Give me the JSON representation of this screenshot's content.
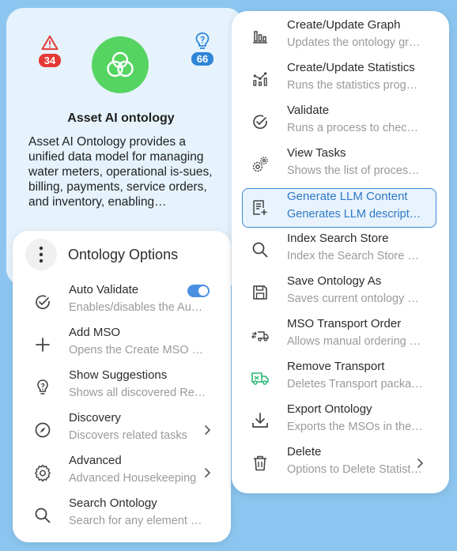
{
  "card": {
    "alert_count": "34",
    "suggestion_count": "66",
    "title": "Asset AI ontology",
    "description": "Asset AI Ontology provides a unified data model for managing water meters, operational is-sues, billing, payments, service orders, and inventory, enabling…",
    "logo_color": "#55d462"
  },
  "left_menu": {
    "title": "Ontology Options",
    "items": [
      {
        "label": "Auto Validate",
        "desc": "Enables/disables the Au…",
        "icon": "check-circle-icon",
        "toggle": true
      },
      {
        "label": "Add MSO",
        "desc": "Opens the Create MSO …",
        "icon": "plus-icon"
      },
      {
        "label": "Show Suggestions",
        "desc": "Shows all discovered Re…",
        "icon": "lightbulb-icon"
      },
      {
        "label": "Discovery",
        "desc": "Discovers related tasks",
        "icon": "compass-icon",
        "submenu": true
      },
      {
        "label": "Advanced",
        "desc": "Advanced Housekeeping",
        "icon": "gear-icon",
        "submenu": true
      },
      {
        "label": "Search Ontology",
        "desc": "Search for any element …",
        "icon": "search-icon"
      }
    ]
  },
  "right_menu": {
    "items": [
      {
        "label": "Create/Update Graph",
        "desc": "Updates the ontology gr…",
        "icon": "bar-chart-icon"
      },
      {
        "label": "Create/Update Statistics",
        "desc": "Runs the statistics prog…",
        "icon": "stats-chart-icon"
      },
      {
        "label": "Validate",
        "desc": "Runs a process to chec…",
        "icon": "check-circle-icon"
      },
      {
        "label": "View Tasks",
        "desc": "Shows the list of proces…",
        "icon": "gears-icon"
      },
      {
        "label": "Generate LLM Content",
        "desc": "Generates LLM descript…",
        "icon": "document-add-icon",
        "selected": true
      },
      {
        "label": "Index Search Store",
        "desc": "Index the Search Store …",
        "icon": "search-icon"
      },
      {
        "label": "Save Ontology As",
        "desc": "Saves current ontology …",
        "icon": "save-icon"
      },
      {
        "label": "MSO Transport Order",
        "desc": "Allows manual ordering …",
        "icon": "transport-order-icon"
      },
      {
        "label": "Remove Transport",
        "desc": "Deletes Transport packa…",
        "icon": "truck-icon"
      },
      {
        "label": "Export Ontology",
        "desc": "Exports the MSOs in the…",
        "icon": "download-icon"
      },
      {
        "label": "Delete",
        "desc": "Options to Delete Statist…",
        "icon": "trash-icon",
        "submenu": true
      }
    ]
  },
  "colors": {
    "background": "#8cc6f0",
    "accent_blue": "#2f78c4",
    "alert_red": "#e53935",
    "toggle_on": "#4a90e2",
    "truck_green": "#2bb673"
  }
}
